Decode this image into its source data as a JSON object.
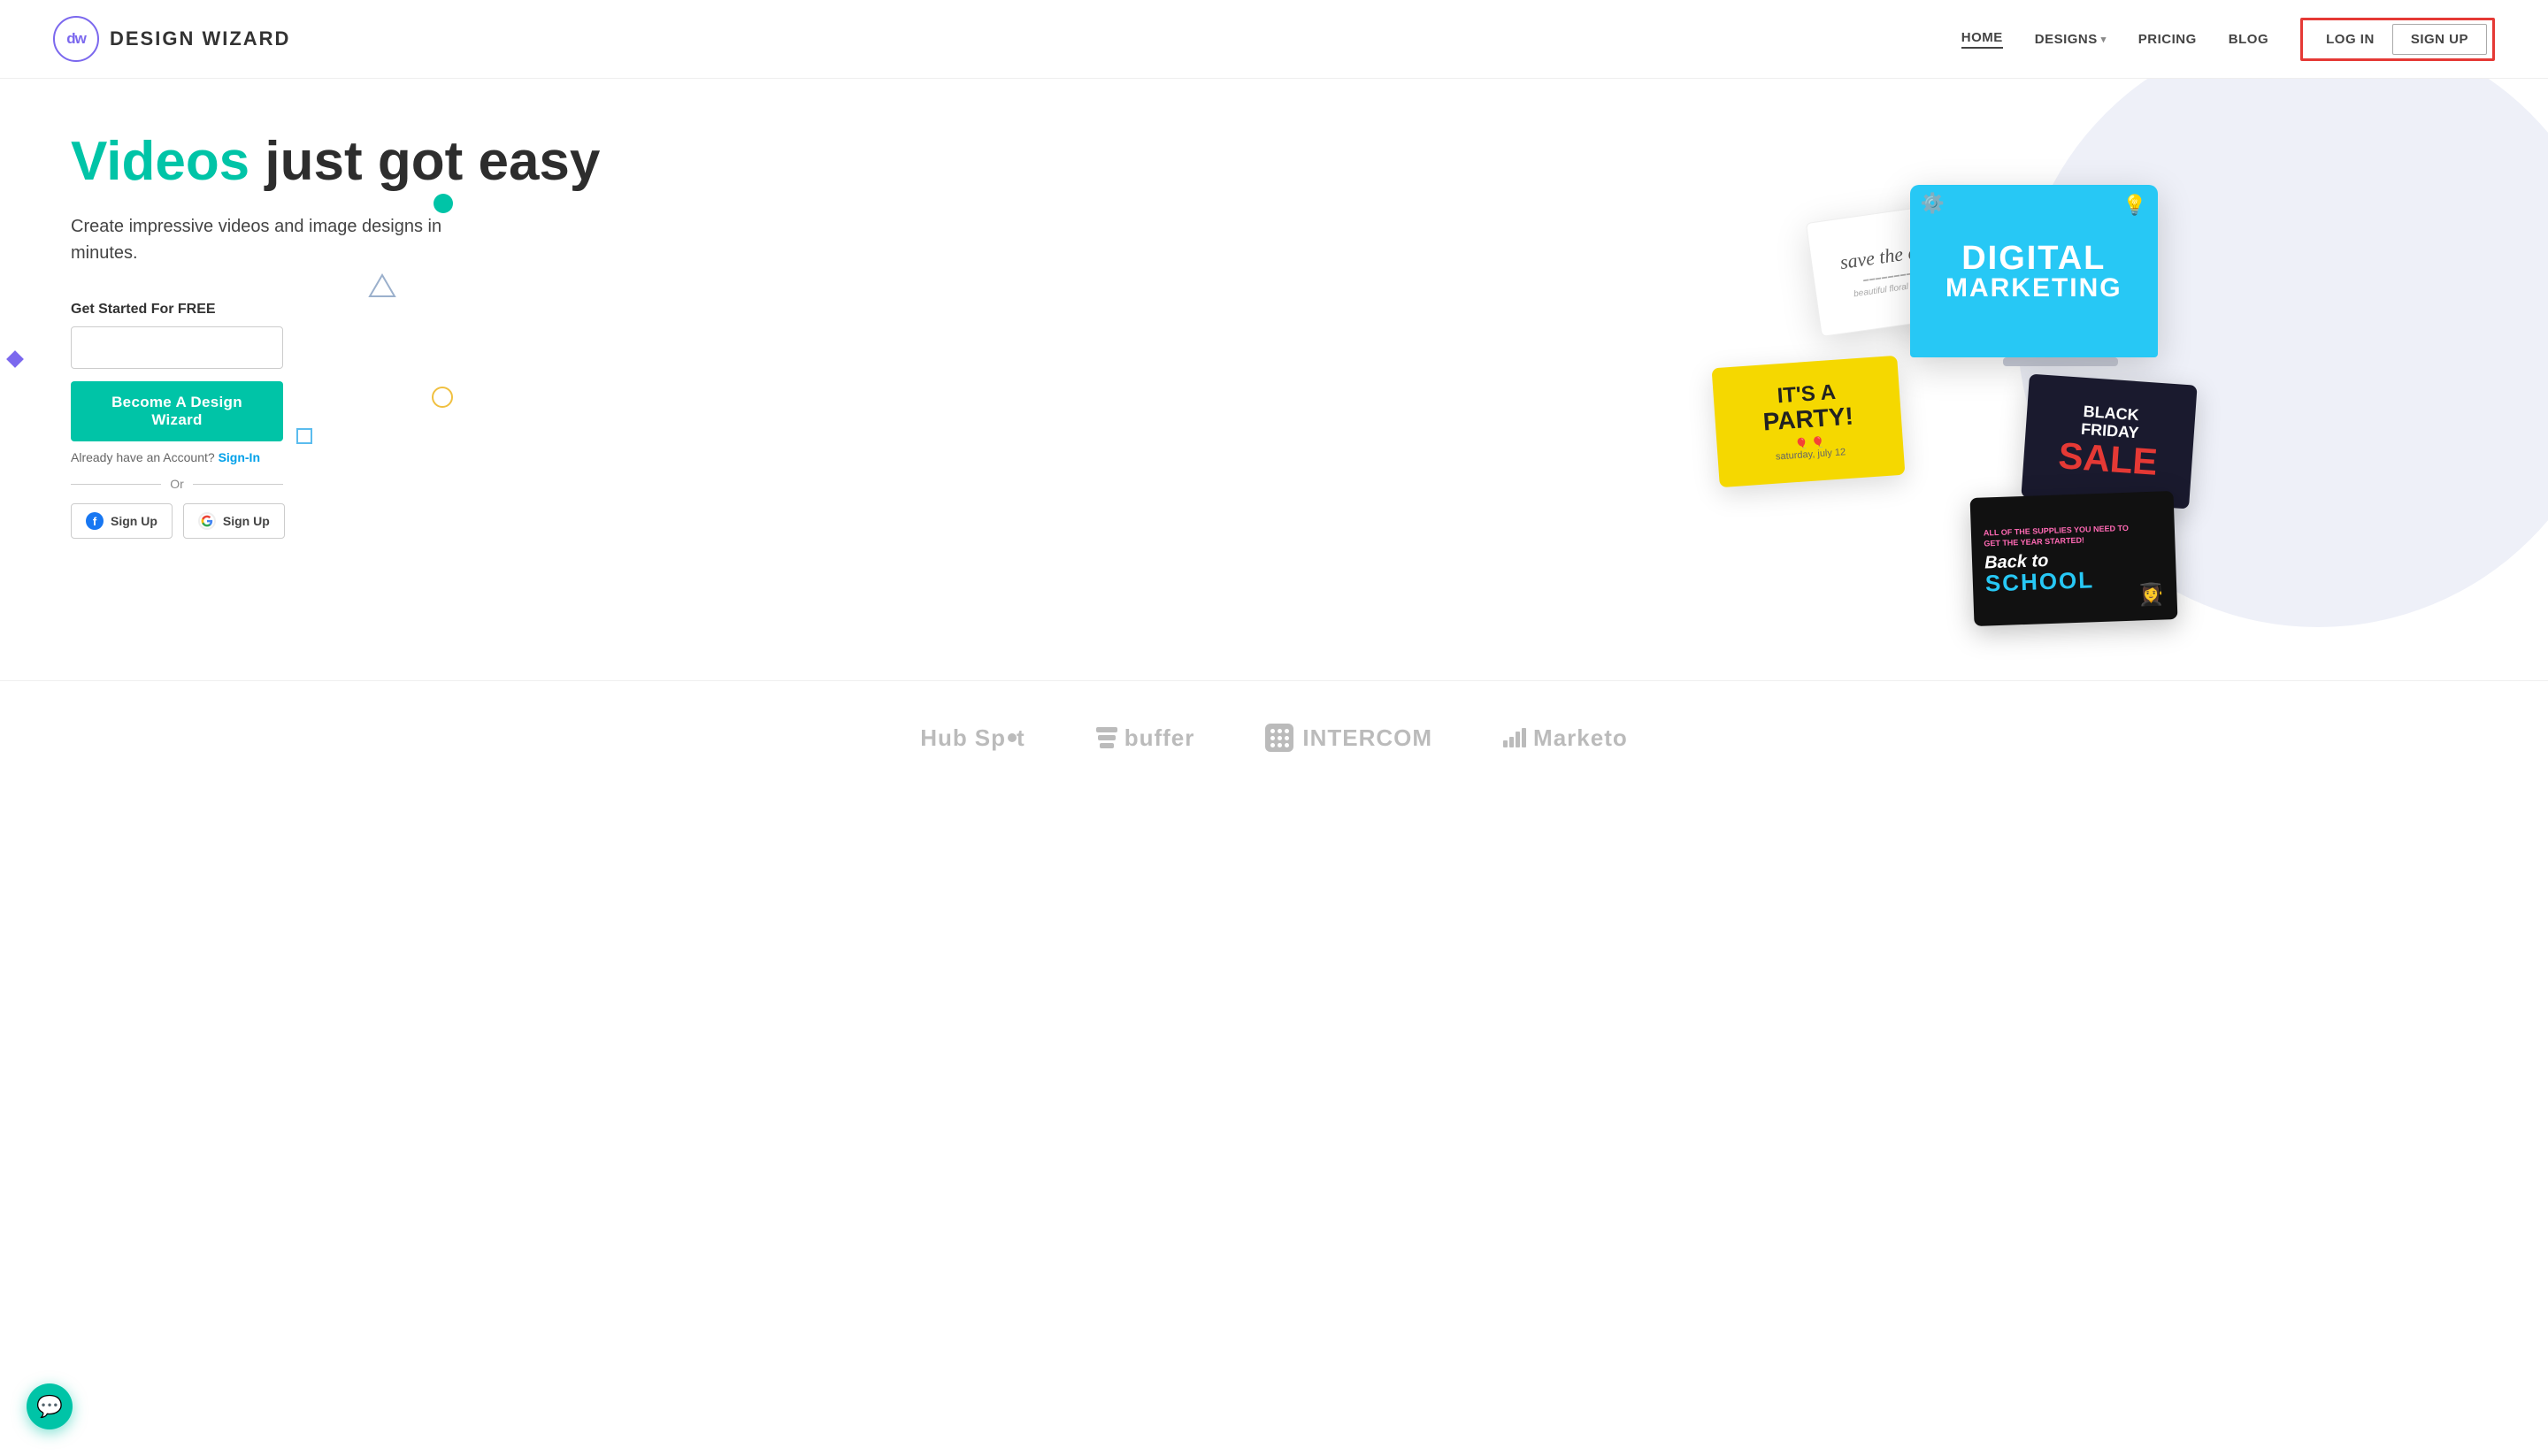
{
  "header": {
    "logo_initials": "dw",
    "logo_name": "DESIGN WIZARD",
    "nav": {
      "home_label": "HOME",
      "designs_label": "DESIGNS",
      "pricing_label": "PRICING",
      "blog_label": "BLOG",
      "login_label": "LOG IN",
      "signup_label": "SIGN UP"
    }
  },
  "hero": {
    "title_highlight": "Videos",
    "title_rest": " just got easy",
    "subtitle": "Create impressive videos and image designs in minutes.",
    "get_started_label": "Get Started For FREE",
    "email_placeholder": "",
    "cta_button": "Become A Design Wizard",
    "already_account": "Already have an Account?",
    "sign_in_label": "Sign-In",
    "or_label": "Or",
    "fb_signup": "Sign Up",
    "google_signup": "Sign Up"
  },
  "design_cards": {
    "digital_marketing": "DIGITAL\nMARKETING",
    "save_the_date": "save the date",
    "party_line1": "IT'S A",
    "party_line2": "PARTY!",
    "black_friday_line1": "BLACK\nFRIDAY",
    "black_friday_sale": "SALE",
    "back_to_school_top": "ALL OF THE SUPPLIES YOU NEED TO GET THE YEAR STARTED!",
    "back_to_school_main": "Back to",
    "back_to_school_sub": "SCHOOL"
  },
  "logos": {
    "hubspot": "HubSpot",
    "buffer": "buffer",
    "intercom": "INTERCOM",
    "marketo": "Marketo"
  },
  "chat": {
    "icon": "💬"
  }
}
